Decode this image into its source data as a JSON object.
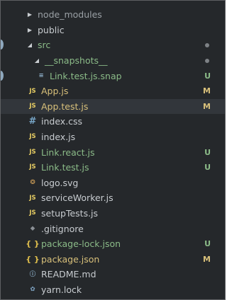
{
  "explorer": {
    "items": [
      {
        "name": "node_modules",
        "type": "folder",
        "expanded": false,
        "depth": 1,
        "color": "dim",
        "badge": ""
      },
      {
        "name": "public",
        "type": "folder",
        "expanded": false,
        "depth": 1,
        "color": "normal",
        "badge": ""
      },
      {
        "name": "src",
        "type": "folder",
        "expanded": true,
        "depth": 1,
        "color": "green",
        "badge": "dot"
      },
      {
        "name": "__snapshots__",
        "type": "folder",
        "expanded": true,
        "depth": 2,
        "color": "green",
        "badge": "dot"
      },
      {
        "name": "Link.test.js.snap",
        "type": "file",
        "icon": "file-lines-icon",
        "depth": 3,
        "color": "green",
        "badge": "U"
      },
      {
        "name": "App.js",
        "type": "file",
        "icon": "js-icon",
        "depth": 2,
        "color": "amber",
        "badge": "M"
      },
      {
        "name": "App.test.js",
        "type": "file",
        "icon": "js-icon",
        "depth": 2,
        "color": "amber",
        "badge": "M",
        "selected": true
      },
      {
        "name": "index.css",
        "type": "file",
        "icon": "css-hash-icon",
        "depth": 2,
        "color": "normal",
        "badge": ""
      },
      {
        "name": "index.js",
        "type": "file",
        "icon": "js-icon",
        "depth": 2,
        "color": "normal",
        "badge": ""
      },
      {
        "name": "Link.react.js",
        "type": "file",
        "icon": "js-icon",
        "depth": 2,
        "color": "green",
        "badge": "U"
      },
      {
        "name": "Link.test.js",
        "type": "file",
        "icon": "js-icon",
        "depth": 2,
        "color": "green",
        "badge": "U"
      },
      {
        "name": "logo.svg",
        "type": "file",
        "icon": "svg-image-icon",
        "depth": 2,
        "color": "normal",
        "badge": ""
      },
      {
        "name": "serviceWorker.js",
        "type": "file",
        "icon": "js-icon",
        "depth": 2,
        "color": "normal",
        "badge": ""
      },
      {
        "name": "setupTests.js",
        "type": "file",
        "icon": "js-icon",
        "depth": 2,
        "color": "normal",
        "badge": ""
      },
      {
        "name": ".gitignore",
        "type": "file",
        "icon": "git-diamond-icon",
        "depth": 1,
        "color": "normal",
        "badge": ""
      },
      {
        "name": "package-lock.json",
        "type": "file",
        "icon": "json-braces-icon",
        "depth": 1,
        "color": "green",
        "badge": "U"
      },
      {
        "name": "package.json",
        "type": "file",
        "icon": "json-braces-icon",
        "depth": 1,
        "color": "amber",
        "badge": "M"
      },
      {
        "name": "README.md",
        "type": "file",
        "icon": "info-circle-icon",
        "depth": 1,
        "color": "normal",
        "badge": ""
      },
      {
        "name": "yarn.lock",
        "type": "file",
        "icon": "yarn-icon",
        "depth": 1,
        "color": "normal",
        "badge": ""
      }
    ]
  },
  "icon_glyphs": {
    "js-icon": "JS",
    "css-hash-icon": "#",
    "json-braces-icon": "{ }",
    "info-circle-icon": "ⓘ",
    "git-diamond-icon": "◆",
    "svg-image-icon": "❂",
    "yarn-icon": "✿",
    "file-lines-icon": "≡"
  },
  "colors": {
    "background": "#25282b",
    "selected_row": "#32363b",
    "text_normal": "#c8ccd0",
    "untracked_green": "#8bbb88",
    "modified_amber": "#d8c07a",
    "js_icon": "#e7cd63"
  }
}
